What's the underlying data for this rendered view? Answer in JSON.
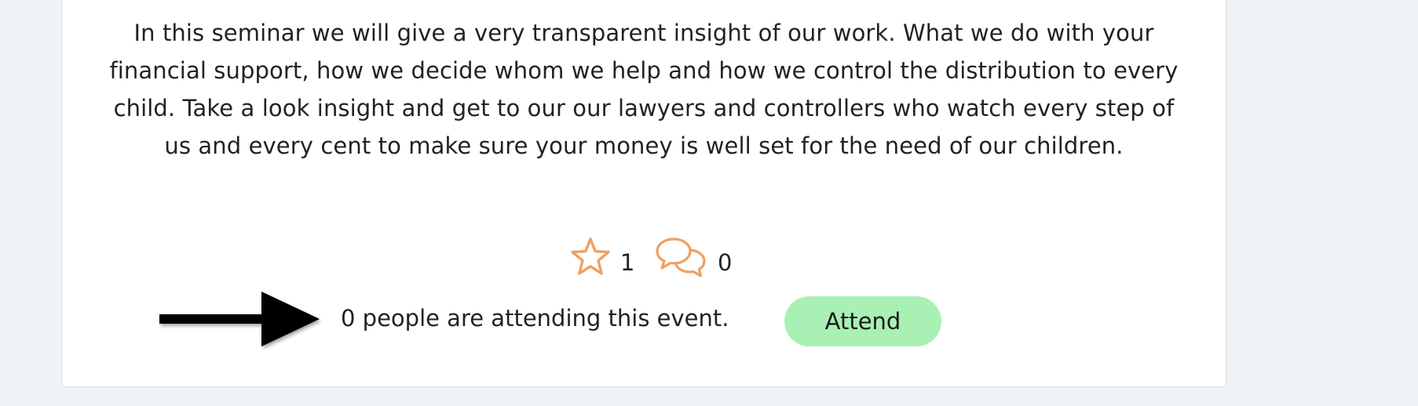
{
  "event": {
    "description": "In this seminar we will give a very transparent insight of our work. What we do with your financial support, how we decide whom we help and how we control the distribution to every child. Take a look insight and get to our our lawyers and controllers who watch every step of us and every cent to make sure your money is well set for the need of our children."
  },
  "stats": {
    "stars": "1",
    "comments": "0",
    "star_icon": "star-icon",
    "comment_icon": "speech-bubbles-icon",
    "icon_color": "#f0a060"
  },
  "attendance": {
    "text": "0 people are attending this event.",
    "button_label": "Attend",
    "button_color": "#a8f0b4"
  },
  "annotation": {
    "arrow": "arrow-right-icon",
    "color": "#000000"
  }
}
